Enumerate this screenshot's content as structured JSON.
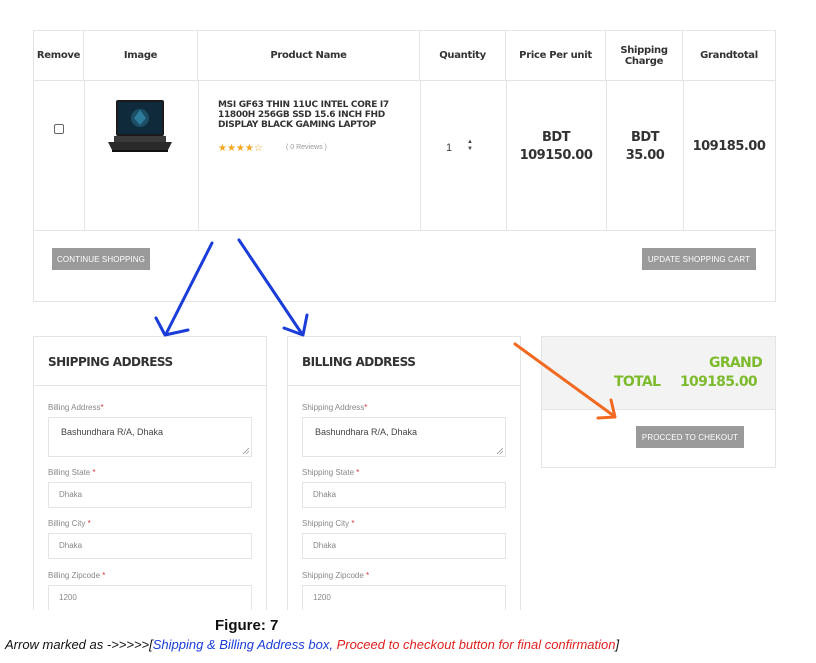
{
  "cart": {
    "headers": [
      "Remove",
      "Image",
      "Product Name",
      "Quantity",
      "Price Per unit",
      "Shipping Charge",
      "Grandtotal"
    ],
    "item": {
      "name": "MSI GF63 THIN 11UC INTEL CORE I7 11800H 256GB SSD 15.6 INCH FHD DISPLAY BLACK GAMING LAPTOP",
      "stars": "★★★★☆",
      "reviews": "( 0 Reviews )",
      "quantity": "1",
      "price_currency": "BDT",
      "price_value": "109150.00",
      "shipping_currency": "BDT",
      "shipping_value": "35.00",
      "grandtotal": "109185.00"
    },
    "continue_label": "CONTINUE SHOPPING",
    "update_label": "UPDATE SHOPPING CART"
  },
  "shipping": {
    "title": "SHIPPING ADDRESS",
    "address_label": "Billing Address",
    "address_value": "Bashundhara R/A, Dhaka",
    "state_label": "Billing State ",
    "state_value": "Dhaka",
    "city_label": "Billing City ",
    "city_value": "Dhaka",
    "zip_label": "Billing Zipcode ",
    "zip_value": "1200"
  },
  "billing": {
    "title": "BILLING ADDRESS",
    "address_label": "Shipping Address",
    "address_value": "Bashundhara R/A, Dhaka",
    "state_label": "Shipping State ",
    "state_value": "Dhaka",
    "city_label": "Shipping City ",
    "city_value": "Dhaka",
    "zip_label": "Shipping Zipcode ",
    "zip_value": "1200"
  },
  "total": {
    "label": "TOTAL",
    "grand_label": "GRAND",
    "grand_value": "109185.00",
    "checkout_label": "PROCCED TO CHEKOUT"
  },
  "annotation": {
    "figure": "Figure: 7",
    "caption_prefix": "Arrow marked as ->>>>>[",
    "caption_blue": "Shipping & Billing Address box,",
    "caption_red": " Proceed to checkout button for final confirmation",
    "caption_suffix": "]"
  },
  "colors": {
    "accent_green": "#7dbb2d",
    "button_gray": "#9a9a9a",
    "arrow_blue": "#1a3cd8",
    "arrow_orange": "#f26a21",
    "required_red": "#d33333"
  }
}
